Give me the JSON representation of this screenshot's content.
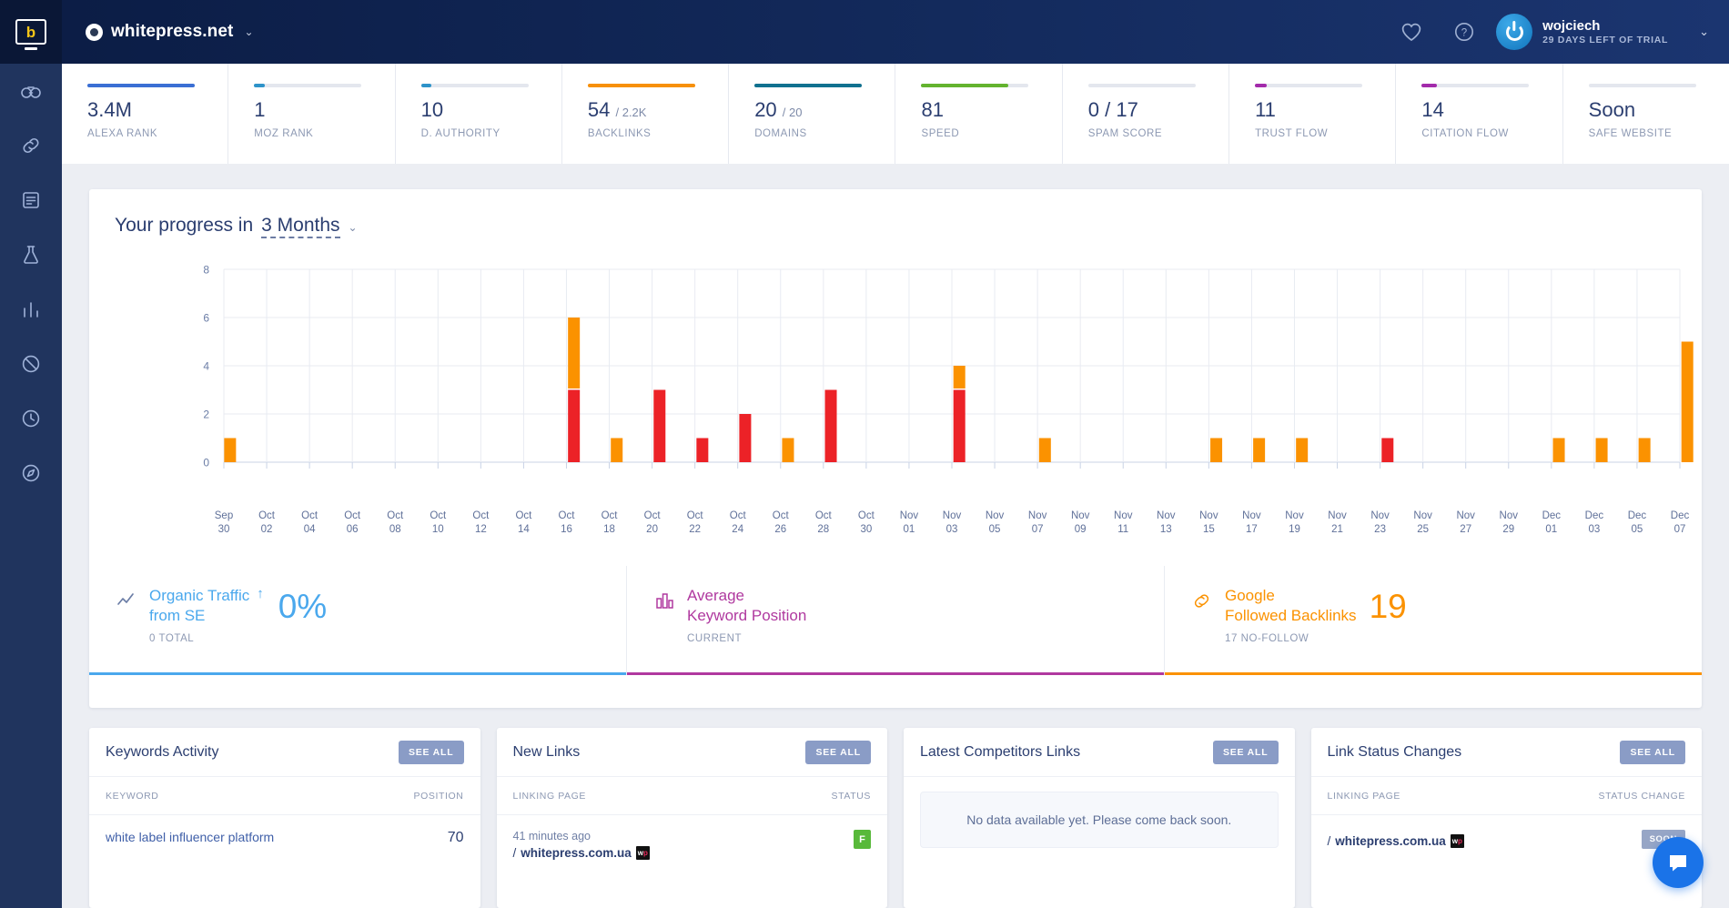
{
  "topbar": {
    "logo_icon": "monitor-b-logo-icon",
    "site_icon": "site-circle-icon",
    "site_name": "whitepress.net",
    "site_chevron": "⌄",
    "favorites_icon": "heart-icon",
    "help_icon": "question-circle-icon",
    "avatar_icon": "power-avatar-icon",
    "user_name": "wojciech",
    "user_trial": "29 DAYS LEFT OF TRIAL",
    "user_chevron": "⌄"
  },
  "rail": {
    "items": [
      {
        "icon": "binoculars-icon",
        "name": "sidebar-item-overview"
      },
      {
        "icon": "link-icon",
        "name": "sidebar-item-links"
      },
      {
        "icon": "list-icon",
        "name": "sidebar-item-reports"
      },
      {
        "icon": "flask-icon",
        "name": "sidebar-item-lab"
      },
      {
        "icon": "bar-chart-icon",
        "name": "sidebar-item-analytics"
      },
      {
        "icon": "block-icon",
        "name": "sidebar-item-disavow"
      },
      {
        "icon": "clock-icon",
        "name": "sidebar-item-history"
      },
      {
        "icon": "compass-icon",
        "name": "sidebar-item-explore"
      }
    ]
  },
  "stats": [
    {
      "value": "3.4M",
      "sub": "",
      "label": "ALEXA RANK",
      "fill": 100,
      "color": "#3b6fd4"
    },
    {
      "value": "1",
      "sub": "",
      "label": "MOZ RANK",
      "fill": 10,
      "color": "#2e93c9"
    },
    {
      "value": "10",
      "sub": "",
      "label": "D. AUTHORITY",
      "fill": 10,
      "color": "#2e93c9"
    },
    {
      "value": "54",
      "sub": "/ 2.2K",
      "label": "BACKLINKS",
      "fill": 100,
      "color": "#f79009"
    },
    {
      "value": "20",
      "sub": "/ 20",
      "label": "DOMAINS",
      "fill": 100,
      "color": "#11718f"
    },
    {
      "value": "81",
      "sub": "",
      "label": "SPEED",
      "fill": 81,
      "color": "#63b32e"
    },
    {
      "value": "0 / 17",
      "sub": "",
      "label": "SPAM SCORE",
      "fill": 0,
      "color": "#63b32e"
    },
    {
      "value": "11",
      "sub": "",
      "label": "TRUST FLOW",
      "fill": 11,
      "color": "#a32bab"
    },
    {
      "value": "14",
      "sub": "",
      "label": "CITATION FLOW",
      "fill": 14,
      "color": "#a32bab"
    },
    {
      "value": "Soon",
      "sub": "",
      "label": "SAFE WEBSITE",
      "fill": 0,
      "color": "#a32bab"
    }
  ],
  "progress": {
    "title_prefix": "Your progress in",
    "range": "3 Months",
    "range_chevron": "⌄"
  },
  "chart_data": {
    "type": "bar",
    "title": "Your progress in 3 Months",
    "xlabel": "",
    "ylabel": "",
    "ylim": [
      0,
      8
    ],
    "yticks": [
      0,
      2,
      4,
      6,
      8
    ],
    "grid": true,
    "legend": false,
    "stacked": true,
    "colors": {
      "followed": "#ec2227",
      "nofollow": "#fb9200"
    },
    "categories": [
      "Sep 30",
      "Oct 02",
      "Oct 04",
      "Oct 06",
      "Oct 08",
      "Oct 10",
      "Oct 12",
      "Oct 14",
      "Oct 16",
      "Oct 18",
      "Oct 20",
      "Oct 22",
      "Oct 24",
      "Oct 26",
      "Oct 28",
      "Oct 30",
      "Nov 01",
      "Nov 03",
      "Nov 05",
      "Nov 07",
      "Nov 09",
      "Nov 11",
      "Nov 13",
      "Nov 15",
      "Nov 17",
      "Nov 19",
      "Nov 21",
      "Nov 23",
      "Nov 25",
      "Nov 27",
      "Nov 29",
      "Dec 01",
      "Dec 03",
      "Dec 05",
      "Dec 07"
    ],
    "series": [
      {
        "name": "Followed",
        "values": [
          0,
          0,
          0,
          0,
          0,
          0,
          0,
          0,
          3,
          0,
          3,
          1,
          2,
          0,
          3,
          0,
          0,
          3,
          0,
          0,
          0,
          0,
          0,
          0,
          0,
          0,
          0,
          1,
          0,
          0,
          0,
          0,
          0,
          0,
          0
        ]
      },
      {
        "name": "No-follow",
        "values": [
          1,
          0,
          0,
          0,
          0,
          0,
          0,
          0,
          3,
          1,
          0,
          0,
          0,
          1,
          0,
          0,
          0,
          1,
          0,
          1,
          0,
          0,
          0,
          1,
          1,
          1,
          0,
          0,
          0,
          0,
          0,
          1,
          1,
          1,
          5
        ]
      }
    ],
    "bar_offsets": [
      0.35,
      1.7,
      1.7,
      1.7,
      1.7,
      1.7,
      1.7,
      1.7,
      1.7,
      1.7,
      1.7,
      1.7,
      1.7,
      1.7,
      1.7,
      1.7,
      1.7,
      1.7,
      1.7,
      1.7,
      1.7,
      1.7,
      1.7,
      1.7,
      1.7,
      1.7,
      1.7,
      1.7,
      1.7,
      1.7,
      1.7,
      1.7,
      1.7,
      1.7,
      1.7
    ]
  },
  "metrics": [
    {
      "icon": "line-chart-icon",
      "title_l1": "Organic Traffic",
      "title_l2": "from SE",
      "sub": "0 TOTAL",
      "arrow": "↑",
      "value": "0%",
      "color": "#4aa8ed",
      "rule": "#4aa8ed"
    },
    {
      "icon": "bar-chart-small-icon",
      "title_l1": "Average",
      "title_l2": "Keyword Position",
      "sub": "CURRENT",
      "arrow": "",
      "value": "",
      "color": "#b0399f",
      "rule": "#b0399f"
    },
    {
      "icon": "chain-link-icon",
      "title_l1": "Google",
      "title_l2": "Followed Backlinks",
      "sub": "17 NO-FOLLOW",
      "arrow": "",
      "value": "19",
      "color": "#fb9200",
      "rule": "#fb9200"
    }
  ],
  "panels": [
    {
      "title": "Keywords Activity",
      "see_all": "SEE ALL",
      "col1": "KEYWORD",
      "col2": "POSITION",
      "row": {
        "kind": "keyword",
        "text": "white label influencer platform",
        "value": "70"
      }
    },
    {
      "title": "New Links",
      "see_all": "SEE ALL",
      "col1": "LINKING PAGE",
      "col2": "STATUS",
      "row": {
        "kind": "link",
        "time": "41 minutes ago",
        "url_prefix": "/",
        "url": "whitepress.com.ua",
        "badge": "F"
      }
    },
    {
      "title": "Latest Competitors Links",
      "see_all": "SEE ALL",
      "col1": "",
      "col2": "",
      "row": {
        "kind": "empty",
        "text": "No data available yet. Please come back soon."
      }
    },
    {
      "title": "Link Status Changes",
      "see_all": "SEE ALL",
      "col1": "LINKING PAGE",
      "col2": "STATUS CHANGE",
      "row": {
        "kind": "status",
        "url_prefix": "/",
        "url": "whitepress.com.ua",
        "badge": "SOON"
      }
    }
  ],
  "chat": {
    "icon": "chat-bubble-icon"
  }
}
